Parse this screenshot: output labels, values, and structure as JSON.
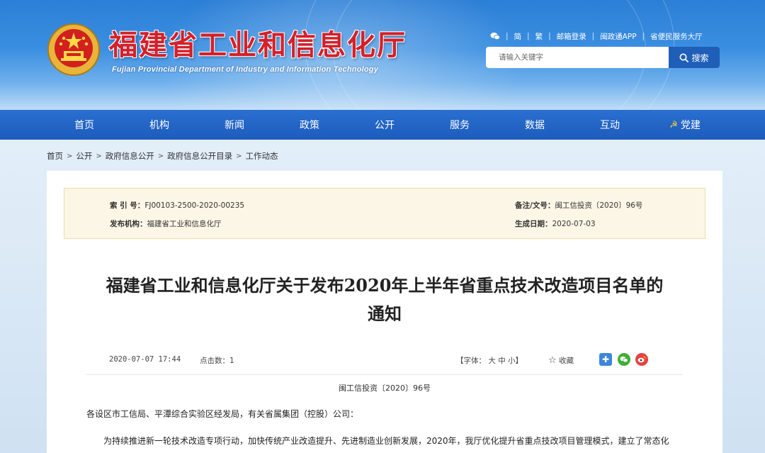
{
  "header": {
    "title": "福建省工业和信息化厅",
    "subtitle": "Fujian Provincial Department of Industry and Information Technology",
    "top_links": [
      "简",
      "繁",
      "邮箱登录",
      "闽政通APP",
      "省便民服务大厅"
    ],
    "search": {
      "placeholder": "请输入关键字",
      "button_label": "搜索"
    }
  },
  "nav": {
    "items": [
      "首页",
      "机构",
      "新闻",
      "政策",
      "公开",
      "服务",
      "数据",
      "互动",
      "党建"
    ]
  },
  "breadcrumb": [
    "首页",
    "公开",
    "政府信息公开",
    "政府信息公开目录",
    "工作动态"
  ],
  "meta": {
    "index_label": "索 引 号：",
    "index_value": "FJ00103-2500-2020-00235",
    "note_label": "备注/文号：",
    "note_value": "闽工信投资〔2020〕96号",
    "publisher_label": "发布机构：",
    "publisher_value": "福建省工业和信息化厅",
    "date_label": "生成日期：",
    "date_value": "2020-07-03"
  },
  "article": {
    "title_line1": "福建省工业和信息化厅关于发布2020年上半年省重点技术改造项目名单的",
    "title_line2": "通知",
    "datetime": "2020-07-07 17:44",
    "hits": "点击数：1",
    "font_label": "【字体：",
    "font_large": "大",
    "font_medium": "中",
    "font_small": "小",
    "font_close": "】",
    "favorite": "收藏",
    "doc_number": "闽工信投资〔2020〕96号",
    "salutation": "各设区市工信局、平潭综合实验区经发局，有关省属集团（控股）公司：",
    "paragraph1": "为持续推进新一轮技术改造专项行动，加快传统产业改造提升、先进制造业创新发展，2020年，我厅优化提升省重点技改项目管理模式，建立了常态化"
  },
  "colors": {
    "brand_red": "#d4202a",
    "nav_blue": "#1c5cbc",
    "search_button": "#1f5fb8",
    "meta_background": "#fcf6e6"
  }
}
